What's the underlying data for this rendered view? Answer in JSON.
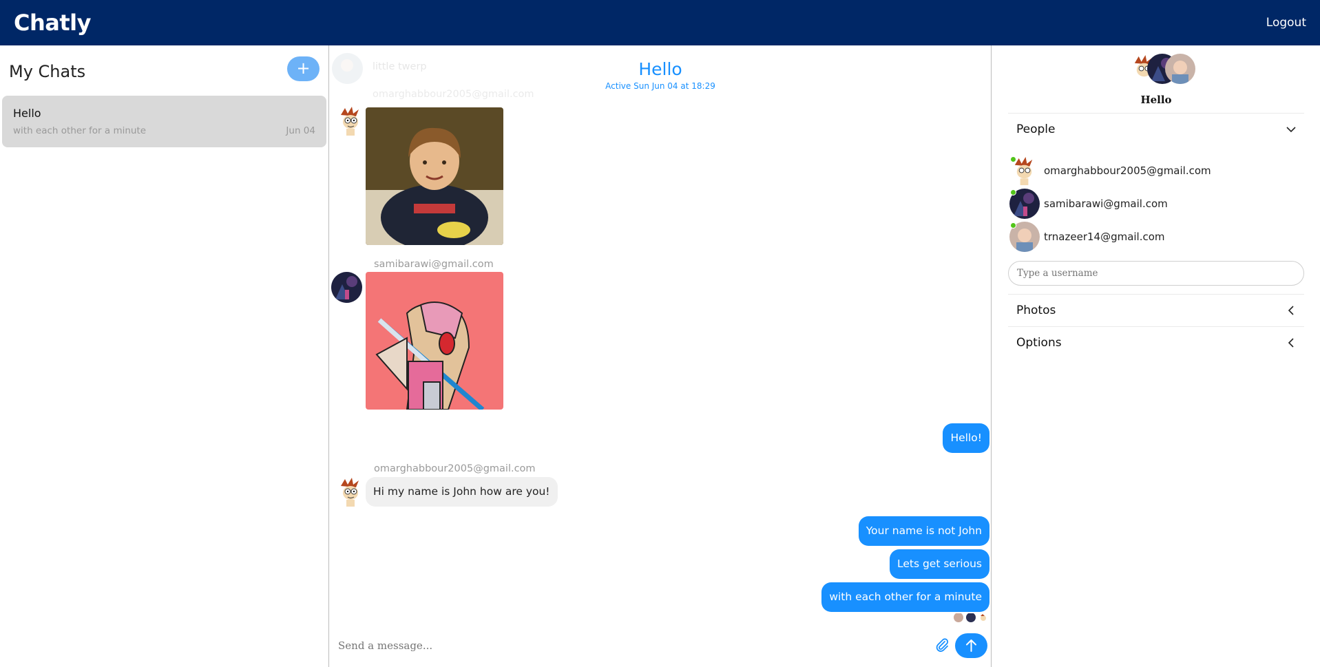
{
  "app": {
    "brand": "Chatly",
    "logout_label": "Logout"
  },
  "sidebar": {
    "title": "My Chats",
    "new_chat_label": "+",
    "chats": [
      {
        "title": "Hello",
        "last_message": "with each other for a minute",
        "date": "Jun 04"
      }
    ]
  },
  "chat": {
    "title": "Hello",
    "subtitle": "Active Sun Jun 04 at 18:29",
    "faded_message": "little twerp",
    "faded_sender": "omarghabbour2005@gmail.com",
    "sender_2": "samibarawi@gmail.com",
    "outgoing_1": "Hello!",
    "sender_3": "omarghabbour2005@gmail.com",
    "incoming_1": "Hi my name is John how are you!",
    "outgoing_2": "Your name is not John",
    "outgoing_3": "Lets get serious",
    "outgoing_4": "with each other for a minute",
    "composer_placeholder": "Send a message..."
  },
  "details": {
    "title": "Hello",
    "people_label": "People",
    "people": [
      {
        "email": "omarghabbour2005@gmail.com",
        "online": true
      },
      {
        "email": "samibarawi@gmail.com",
        "online": true
      },
      {
        "email": "trnazeer14@gmail.com",
        "online": true
      }
    ],
    "username_placeholder": "Type a username",
    "photos_label": "Photos",
    "options_label": "Options"
  },
  "colors": {
    "topbar": "#002766",
    "accent": "#1890ff",
    "online": "#52c41a"
  }
}
